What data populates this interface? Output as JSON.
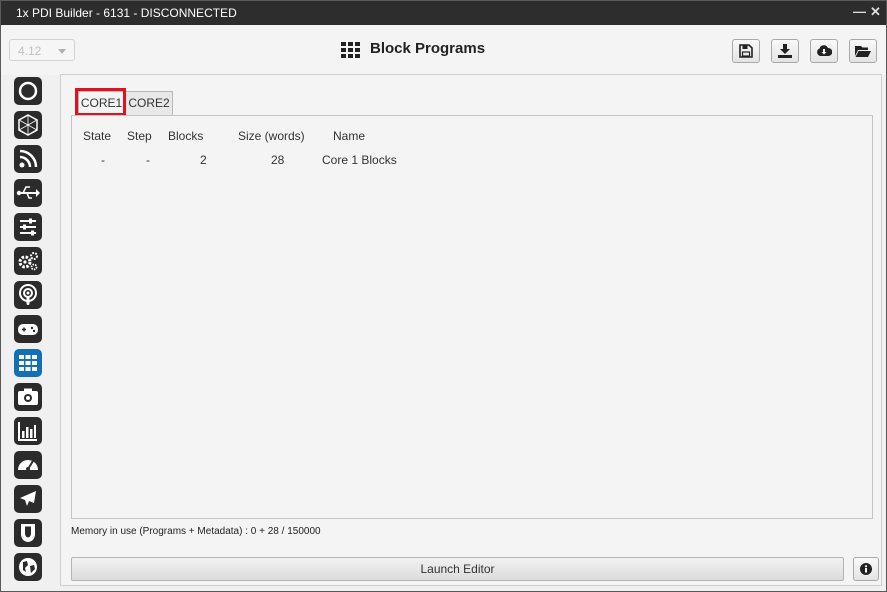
{
  "window": {
    "title": "1x PDI Builder - 6131 - DISCONNECTED",
    "minimize_label": "—",
    "close_label": "✕"
  },
  "topbar": {
    "version_value": "4.12",
    "page_title": "Block Programs",
    "buttons": [
      {
        "name": "save-icon"
      },
      {
        "name": "download-icon"
      },
      {
        "name": "cloud-download-icon"
      },
      {
        "name": "folder-open-icon"
      }
    ]
  },
  "sidebar": {
    "items": [
      {
        "icon": "power-ring-icon"
      },
      {
        "icon": "hexagon-mesh-icon"
      },
      {
        "icon": "rss-feed-icon"
      },
      {
        "icon": "usb-icon"
      },
      {
        "icon": "sliders-icon"
      },
      {
        "icon": "gears-icon"
      },
      {
        "icon": "podcast-icon"
      },
      {
        "icon": "gamepad-icon"
      },
      {
        "icon": "block-grid-icon",
        "active": true
      },
      {
        "icon": "camera-icon"
      },
      {
        "icon": "bar-chart-icon"
      },
      {
        "icon": "gauge-icon"
      },
      {
        "icon": "airplane-icon"
      },
      {
        "icon": "shield-icon"
      },
      {
        "icon": "globe-icon"
      }
    ],
    "active_color": "#1470b4",
    "icon_color": "#2b2b2b"
  },
  "tabs": [
    {
      "label": "CORE1",
      "active": true
    },
    {
      "label": "CORE2",
      "active": false
    }
  ],
  "table": {
    "headers": [
      "State",
      "Step",
      "Blocks",
      "Size (words)",
      "Name"
    ],
    "rows": [
      [
        "-",
        "-",
        "2",
        "28",
        "Core 1 Blocks"
      ]
    ]
  },
  "memory_text": "Memory in use (Programs + Metadata) : 0 + 28 / 150000",
  "launch_label": "Launch Editor",
  "colors": {
    "highlight": "#e3111b",
    "titlebar": "#2d2d2d"
  }
}
